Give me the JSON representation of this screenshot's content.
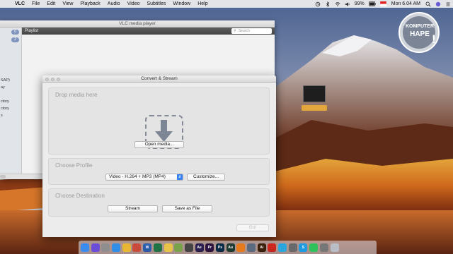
{
  "menubar": {
    "app_name": "VLC",
    "items": [
      "File",
      "Edit",
      "View",
      "Playback",
      "Audio",
      "Video",
      "Subtitles",
      "Window",
      "Help"
    ],
    "battery": "99%",
    "clock": "Mon 6.04 AM"
  },
  "vlc_window": {
    "title": "VLC media player",
    "playlist_label": "Playlist",
    "search_placeholder": "Search",
    "sidebar_items": [
      "SAP)",
      "ay",
      "ctory",
      "ctory",
      "s"
    ],
    "sidebar_badges": [
      "0",
      "2"
    ]
  },
  "convert_dialog": {
    "title": "Convert & Stream",
    "drop_media_title": "Drop media here",
    "open_media_label": "Open media...",
    "choose_profile_title": "Choose Profile",
    "profile_value": "Video - H.264 + MP3 (MP4)",
    "customize_label": "Customize...",
    "choose_destination_title": "Choose Destination",
    "stream_label": "Stream",
    "save_as_file_label": "Save as File",
    "go_label": "Go!"
  },
  "watermark": {
    "line1": "KOMPUTER",
    "line2": "HAPE"
  },
  "colors": {
    "menubar": "#ececec",
    "accent_select": "#3a82f3",
    "section_title": "#9c9c9c",
    "file_label": "#e3a63c"
  },
  "dock": {
    "icons": [
      {
        "name": "finder-icon",
        "color": "#3c8cf0",
        "glyph": ""
      },
      {
        "name": "siri-icon",
        "color": "#6a4fd6",
        "glyph": ""
      },
      {
        "name": "launchpad-icon",
        "color": "#8e8e8e",
        "glyph": ""
      },
      {
        "name": "safari-icon",
        "color": "#2f8fe8",
        "glyph": ""
      },
      {
        "name": "chrome-icon",
        "color": "#e8b632",
        "glyph": ""
      },
      {
        "name": "file-icon",
        "color": "#c94b3b",
        "glyph": ""
      },
      {
        "name": "word-icon",
        "color": "#2c5da9",
        "glyph": "W"
      },
      {
        "name": "excel-icon",
        "color": "#217346",
        "glyph": ""
      },
      {
        "name": "notes-icon",
        "color": "#e8c34a",
        "glyph": ""
      },
      {
        "name": "photos-icon",
        "color": "#7aa24c",
        "glyph": ""
      },
      {
        "name": "app-icon",
        "color": "#444444",
        "glyph": ""
      },
      {
        "name": "after-effects-icon",
        "color": "#2a1f4f",
        "glyph": "Ae"
      },
      {
        "name": "premiere-icon",
        "color": "#2c1440",
        "glyph": "Pr"
      },
      {
        "name": "photoshop-icon",
        "color": "#0b2a45",
        "glyph": "Ps"
      },
      {
        "name": "audition-icon",
        "color": "#1f3a31",
        "glyph": "Au"
      },
      {
        "name": "vlc-icon",
        "color": "#e87a1e",
        "glyph": ""
      },
      {
        "name": "app-icon-2",
        "color": "#5a6a80",
        "glyph": ""
      },
      {
        "name": "illustrator-icon",
        "color": "#3a1f0a",
        "glyph": "Ai"
      },
      {
        "name": "acrobat-icon",
        "color": "#c8281e",
        "glyph": ""
      },
      {
        "name": "telegram-icon",
        "color": "#2ea5dc",
        "glyph": ""
      },
      {
        "name": "app-icon-3",
        "color": "#6a6a6a",
        "glyph": ""
      },
      {
        "name": "skype-icon",
        "color": "#1e9be0",
        "glyph": "S"
      },
      {
        "name": "whatsapp-icon",
        "color": "#2fc25a",
        "glyph": ""
      },
      {
        "name": "app-icon-4",
        "color": "#777777",
        "glyph": ""
      },
      {
        "name": "trash-icon",
        "color": "#b9bec6",
        "glyph": ""
      }
    ]
  }
}
